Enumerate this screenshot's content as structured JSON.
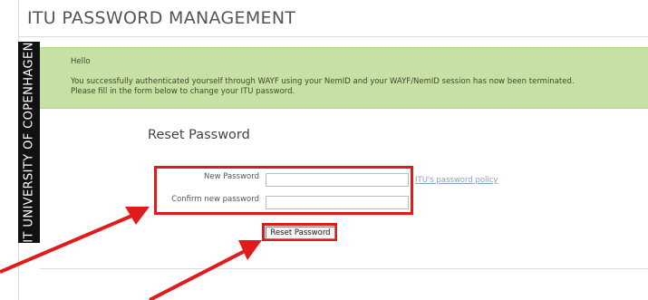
{
  "header": {
    "title": "ITU PASSWORD MANAGEMENT",
    "sidebar_text": "IT UNIVERSITY OF COPENHAGEN"
  },
  "notice": {
    "greeting": "Hello",
    "line1": "You successfully authenticated yourself through WAYF using your NemID and your WAYF/NemID session has now been terminated.",
    "line2": "Please fill in the form below to change your ITU password."
  },
  "form": {
    "heading": "Reset Password",
    "new_password_label": "New Password",
    "confirm_password_label": "Confirm new password",
    "new_password_value": "",
    "confirm_password_value": "",
    "policy_link": "ITU's password policy",
    "submit_label": "Reset Password"
  },
  "colors": {
    "highlight": "#e01b1b",
    "notice_bg": "#c7e1a5",
    "sidebar_bg": "#111111"
  }
}
